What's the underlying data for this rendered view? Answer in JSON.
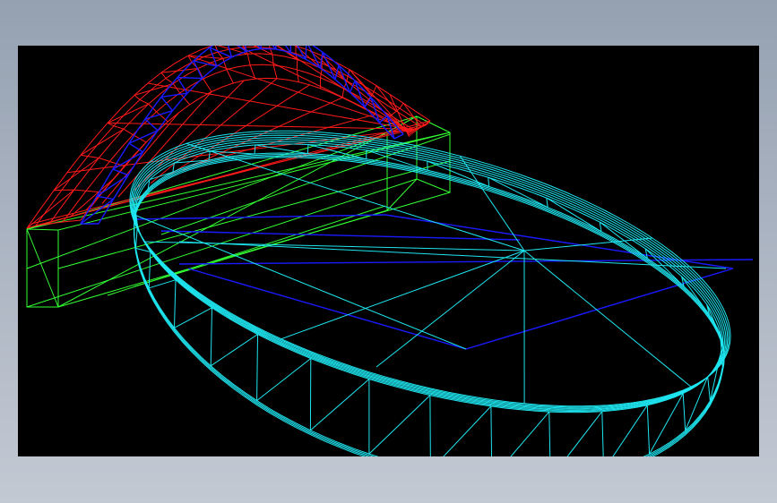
{
  "window": {
    "background_top": "#95a1b1",
    "background_bottom": "#c3c9d3"
  },
  "viewport": {
    "background": "#000000",
    "view_mode": "wireframe"
  },
  "model": {
    "parts": [
      {
        "name": "dome-cover",
        "color": "#ff1a1a"
      },
      {
        "name": "inner-arch-truss",
        "color": "#1a1aff"
      },
      {
        "name": "base-block",
        "color": "#33ff33"
      },
      {
        "name": "oval-basin",
        "color": "#1ee6f0"
      }
    ]
  }
}
